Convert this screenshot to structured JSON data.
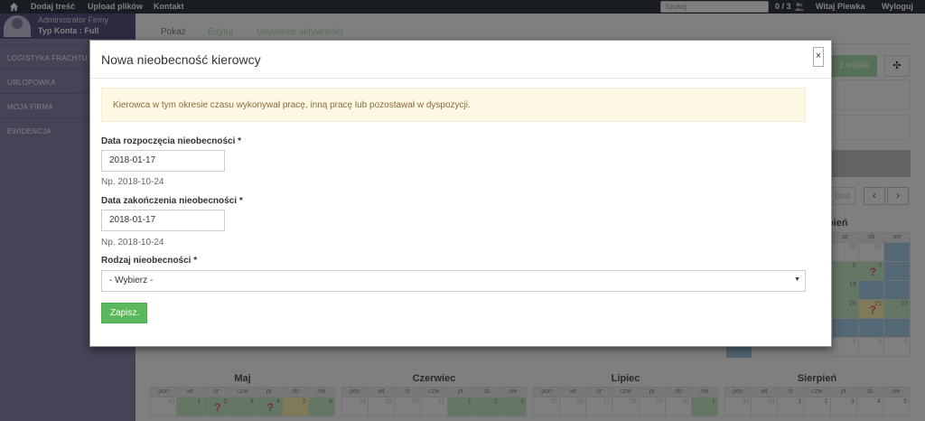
{
  "topbar": {
    "home_icon": "home-icon",
    "nav": [
      "Dodaj treść",
      "Upload plików",
      "Kontakt"
    ],
    "search_placeholder": "Szukaj",
    "users_count": "0 / 3",
    "users_icon": "users-icon",
    "greeting_prefix": "Witaj",
    "greeting_name": "Plewka",
    "logout": "Wyloguj"
  },
  "sidebar": {
    "role": "Administrator Firmy",
    "account": "Typ Konta : Full",
    "items": [
      "LOGISTYKA FRACHTU",
      "URLOPÓWKA",
      "MOJA FIRMA",
      "EWIDENCJA"
    ]
  },
  "page": {
    "tabs": [
      "Pokaż",
      "Edytuj",
      "Usuwanie aktywności"
    ],
    "view_button": "ż widok",
    "move_icon": "move-icon",
    "today_button": "Dziś",
    "prev_icon": "chevron-left-icon",
    "next_icon": "chevron-right-icon",
    "month_fragment": "pień",
    "weekday_headers": [
      "pon",
      "wt",
      "śr",
      "czw",
      "pt",
      "sb",
      "nie"
    ],
    "right_calendar": {
      "visible_headers": [
        "pt",
        "sb",
        "nie"
      ],
      "rows": [
        [
          "29",
          "30",
          "31"
        ],
        [
          "6",
          "7",
          ""
        ],
        [
          "13",
          "",
          ""
        ],
        [
          "20",
          "21",
          "22"
        ],
        [
          "",
          "",
          ""
        ],
        [
          "4",
          "5",
          "6"
        ]
      ]
    },
    "months": [
      {
        "name": "Maj",
        "row1": [
          "30",
          "1",
          "2",
          "3",
          "4",
          "5",
          "6"
        ],
        "question_days": [
          "śr",
          "pt"
        ]
      },
      {
        "name": "Czerwiec",
        "row1": [
          "28",
          "29",
          "30",
          "31",
          "1",
          "2",
          "3"
        ]
      },
      {
        "name": "Lipiec",
        "row1": [
          "25",
          "26",
          "27",
          "28",
          "29",
          "30",
          "1"
        ]
      },
      {
        "name": "Sierpień",
        "row1": [
          "30",
          "31",
          "1",
          "2",
          "3",
          "4",
          "5"
        ]
      }
    ]
  },
  "modal": {
    "title": "Nowa nieobecność kierowcy",
    "close": "×",
    "alert": "Kierowca w tym okresie czasu wykonywał pracę, inną pracę lub pozostawał w dyspozycji.",
    "start_label": "Data rozpoczęcia nieobecności *",
    "start_value": "2018-01-17",
    "start_hint": "Np. 2018-10-24",
    "end_label": "Data zakończenia nieobecności *",
    "end_value": "2018-01-17",
    "end_hint": "Np. 2018-10-24",
    "type_label": "Rodzaj nieobecności *",
    "type_selected": "- Wybierz -",
    "save": "Zapisz."
  },
  "colors": {
    "topbar": "#323a45",
    "sidebar": "#8a86ab",
    "green": "#5cb85c",
    "cal_green": "#c8edc9",
    "cal_blue": "#a7cfe9",
    "cal_yellow": "#fff4b0",
    "question": "#f0626e"
  }
}
